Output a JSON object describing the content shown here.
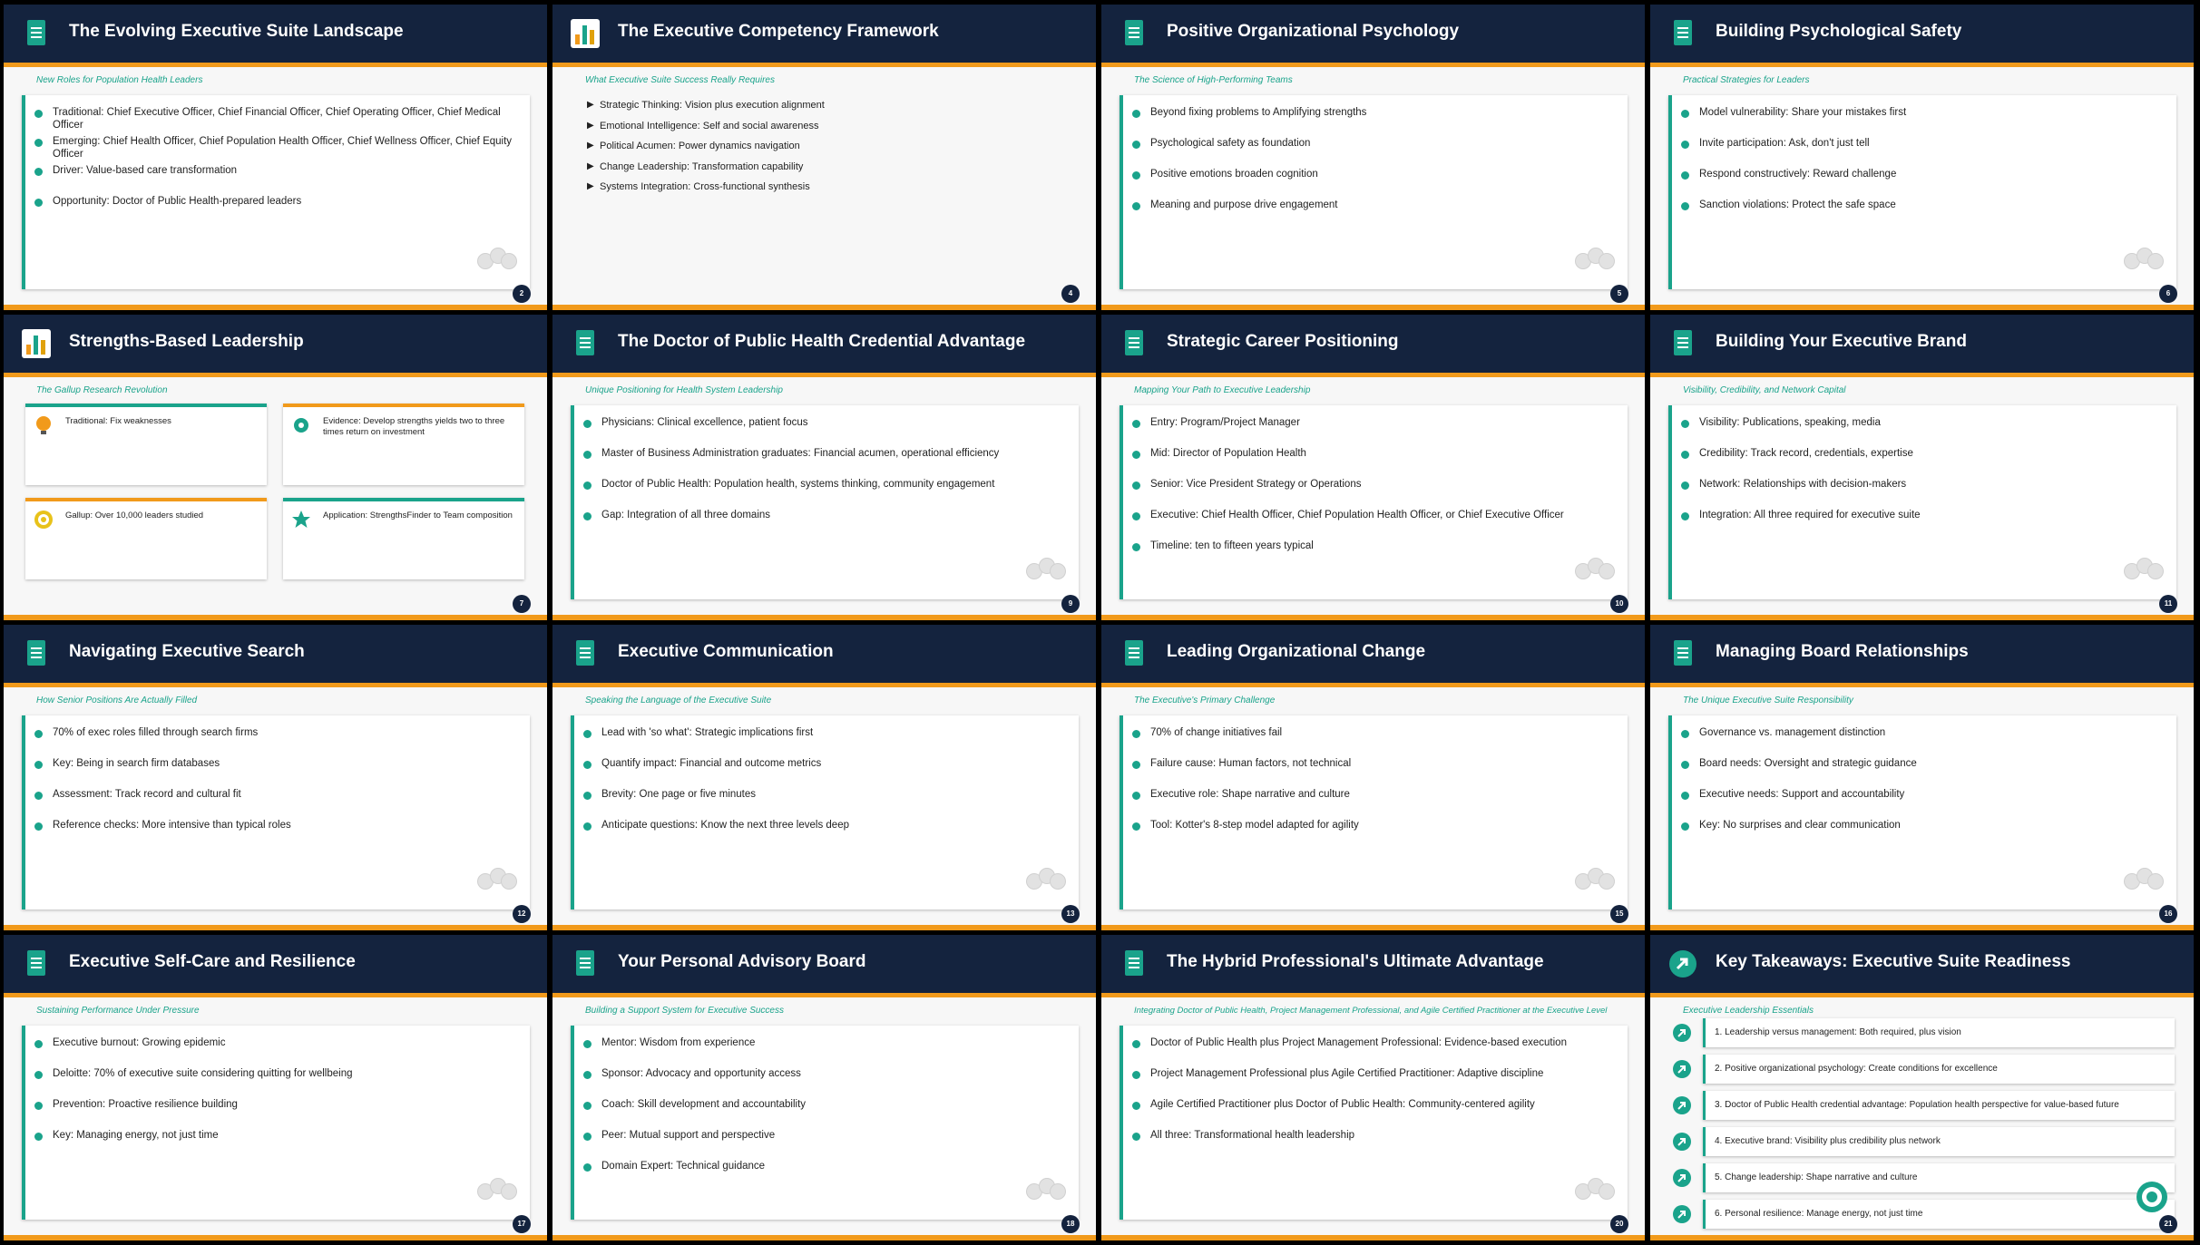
{
  "colors": {
    "header": "#14233e",
    "accent": "#1aa38b",
    "orange": "#f19a1b"
  },
  "slides": [
    {
      "num": "2",
      "title": "The Evolving Executive Suite Landscape",
      "subtitle": "New Roles for Population Health Leaders",
      "bullets": [
        "Traditional: Chief Executive Officer, Chief Financial Officer, Chief Operating Officer, Chief Medical Officer",
        "Emerging: Chief Health Officer, Chief Population Health Officer, Chief Wellness Officer, Chief Equity Officer",
        "Driver: Value-based care transformation",
        "Opportunity: Doctor of Public Health-prepared leaders"
      ]
    },
    {
      "num": "4",
      "title": "The Executive Competency Framework",
      "subtitle": "What Executive Suite Success Really Requires",
      "bullets": [
        "Strategic Thinking: Vision plus execution alignment",
        "Emotional Intelligence: Self and social awareness",
        "Political Acumen: Power dynamics navigation",
        "Change Leadership: Transformation capability",
        "Systems Integration: Cross-functional synthesis"
      ]
    },
    {
      "num": "5",
      "title": "Positive Organizational Psychology",
      "subtitle": "The Science of High-Performing Teams",
      "bullets": [
        "Beyond fixing problems to Amplifying strengths",
        "Psychological safety as foundation",
        "Positive emotions broaden cognition",
        "Meaning and purpose drive engagement"
      ]
    },
    {
      "num": "6",
      "title": "Building Psychological Safety",
      "subtitle": "Practical Strategies for Leaders",
      "bullets": [
        "Model vulnerability: Share your mistakes first",
        "Invite participation: Ask, don't just tell",
        "Respond constructively: Reward challenge",
        "Sanction violations: Protect the safe space"
      ]
    },
    {
      "num": "7",
      "title": "Strengths-Based Leadership",
      "subtitle": "The Gallup Research Revolution",
      "boxes": [
        "Traditional: Fix weaknesses",
        "Evidence: Develop strengths yields two to three times return on investment",
        "Gallup: Over 10,000 leaders studied",
        "Application: StrengthsFinder to Team composition"
      ]
    },
    {
      "num": "9",
      "title": "The Doctor of Public Health Credential Advantage",
      "subtitle": "Unique Positioning for Health System Leadership",
      "bullets": [
        "Physicians: Clinical excellence, patient focus",
        "Master of Business Administration graduates: Financial acumen, operational efficiency",
        "Doctor of Public Health: Population health, systems thinking, community engagement",
        "Gap: Integration of all three domains"
      ]
    },
    {
      "num": "10",
      "title": "Strategic Career Positioning",
      "subtitle": "Mapping Your Path to Executive Leadership",
      "bullets": [
        "Entry: Program/Project Manager",
        "Mid: Director of Population Health",
        "Senior: Vice President Strategy or Operations",
        "Executive: Chief Health Officer, Chief Population Health Officer, or Chief Executive Officer",
        "Timeline: ten to fifteen years typical"
      ]
    },
    {
      "num": "11",
      "title": "Building Your Executive Brand",
      "subtitle": "Visibility, Credibility, and Network Capital",
      "bullets": [
        "Visibility: Publications, speaking, media",
        "Credibility: Track record, credentials, expertise",
        "Network: Relationships with decision-makers",
        "Integration: All three required for executive suite"
      ]
    },
    {
      "num": "12",
      "title": "Navigating Executive Search",
      "subtitle": "How Senior Positions Are Actually Filled",
      "bullets": [
        "70% of exec roles filled through search firms",
        "Key: Being in search firm databases",
        "Assessment: Track record and cultural fit",
        "Reference checks: More intensive than typical roles"
      ]
    },
    {
      "num": "13",
      "title": "Executive Communication",
      "subtitle": "Speaking the Language of the Executive Suite",
      "bullets": [
        "Lead with 'so what': Strategic implications first",
        "Quantify impact: Financial and outcome metrics",
        "Brevity: One page or five minutes",
        "Anticipate questions: Know the next three levels deep"
      ]
    },
    {
      "num": "15",
      "title": "Leading Organizational Change",
      "subtitle": "The Executive's Primary Challenge",
      "bullets": [
        "70% of change initiatives fail",
        "Failure cause: Human factors, not technical",
        "Executive role: Shape narrative and culture",
        "Tool: Kotter's 8-step model adapted for agility"
      ]
    },
    {
      "num": "16",
      "title": "Managing Board Relationships",
      "subtitle": "The Unique Executive Suite Responsibility",
      "bullets": [
        "Governance vs. management distinction",
        "Board needs: Oversight and strategic guidance",
        "Executive needs: Support and accountability",
        "Key: No surprises and clear communication"
      ]
    },
    {
      "num": "17",
      "title": "Executive Self-Care and Resilience",
      "subtitle": "Sustaining Performance Under Pressure",
      "bullets": [
        "Executive burnout: Growing epidemic",
        "Deloitte: 70% of executive suite considering quitting for wellbeing",
        "Prevention: Proactive resilience building",
        "Key: Managing energy, not just time"
      ]
    },
    {
      "num": "18",
      "title": "Your Personal Advisory Board",
      "subtitle": "Building a Support System for Executive Success",
      "bullets": [
        "Mentor: Wisdom from experience",
        "Sponsor: Advocacy and opportunity access",
        "Coach: Skill development and accountability",
        "Peer: Mutual support and perspective",
        "Domain Expert: Technical guidance"
      ]
    },
    {
      "num": "20",
      "title": "The Hybrid Professional's Ultimate Advantage",
      "subtitle": "Integrating Doctor of Public Health, Project Management Professional, and Agile Certified Practitioner at the Executive Level",
      "bullets": [
        "Doctor of Public Health plus Project Management Professional: Evidence-based execution",
        "Project Management Professional plus Agile Certified Practitioner: Adaptive discipline",
        "Agile Certified Practitioner plus Doctor of Public Health: Community-centered agility",
        "All three: Transformational health leadership"
      ]
    },
    {
      "num": "21",
      "title": "Key Takeaways: Executive Suite Readiness",
      "subtitle": "Executive Leadership Essentials",
      "takeaways": [
        "1. Leadership versus management: Both required, plus vision",
        "2. Positive organizational psychology: Create conditions for excellence",
        "3. Doctor of Public Health credential advantage: Population health perspective for value-based future",
        "4. Executive brand: Visibility plus credibility plus network",
        "5. Change leadership: Shape narrative and culture",
        "6. Personal resilience: Manage energy, not just time"
      ]
    }
  ]
}
